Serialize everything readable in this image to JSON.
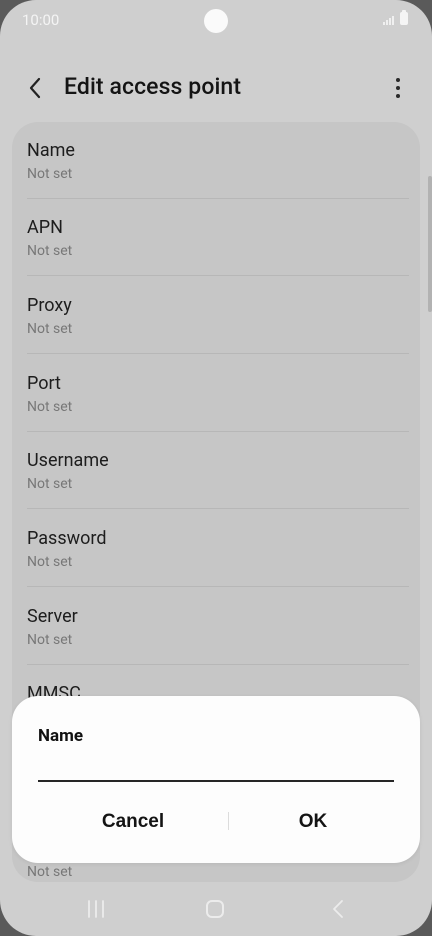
{
  "status_bar": {
    "time": "10:00"
  },
  "header": {
    "title": "Edit access point"
  },
  "list": {
    "items": [
      {
        "title": "Name",
        "value": "Not set"
      },
      {
        "title": "APN",
        "value": "Not set"
      },
      {
        "title": "Proxy",
        "value": "Not set"
      },
      {
        "title": "Port",
        "value": "Not set"
      },
      {
        "title": "Username",
        "value": "Not set"
      },
      {
        "title": "Password",
        "value": "Not set"
      },
      {
        "title": "Server",
        "value": "Not set"
      },
      {
        "title": "MMSC",
        "value": ""
      }
    ],
    "bottom_value": "Not set"
  },
  "dialog": {
    "title": "Name",
    "input_value": "",
    "cancel_label": "Cancel",
    "ok_label": "OK"
  },
  "icons": {
    "back": "chevron-left-icon",
    "more": "more-vertical-icon",
    "nav_recent": "recent-apps-icon",
    "nav_home": "home-icon",
    "nav_back": "back-icon"
  },
  "colors": {
    "background": "#cfcfcf",
    "card": "#c6c6c6",
    "dialog": "#fdfdfd",
    "text_primary": "#1d1d1d",
    "text_secondary": "#777777"
  }
}
